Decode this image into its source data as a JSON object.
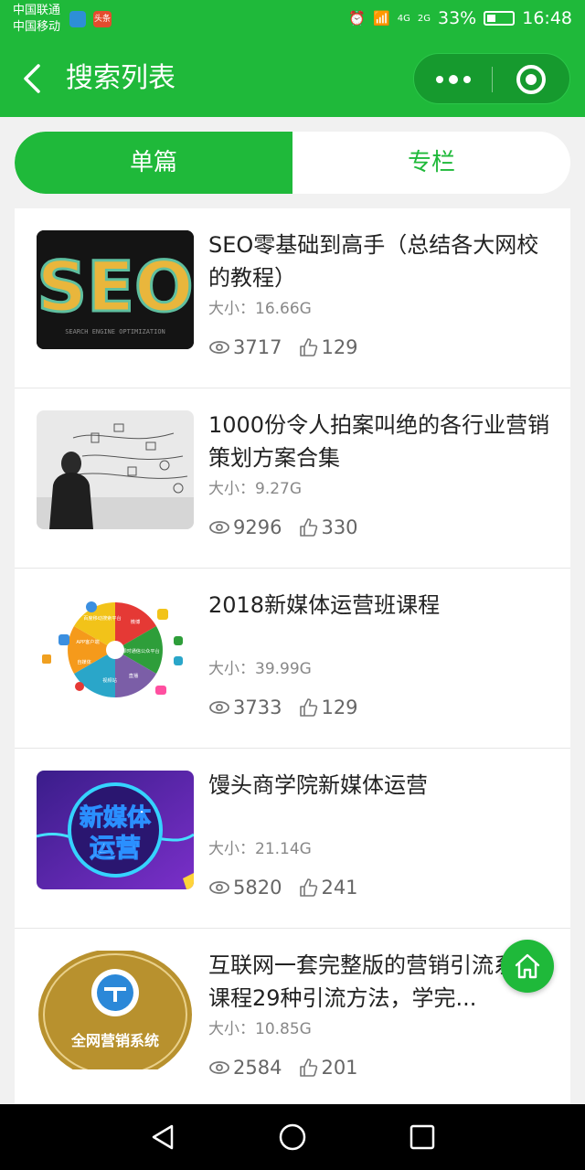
{
  "status_bar": {
    "carrier1": "中国联通",
    "carrier2": "中国移动",
    "app_badge": "头条",
    "net1": "4G",
    "net2": "2G",
    "battery": "33%",
    "time": "16:48"
  },
  "nav": {
    "title": "搜索列表"
  },
  "tabs": [
    {
      "label": "单篇"
    },
    {
      "label": "专栏"
    }
  ],
  "items": [
    {
      "title": "SEO零基础到高手（总结各大网校的教程）",
      "size": "大小：16.66G",
      "views": "3717",
      "likes": "129",
      "thumb_text": "SEO",
      "thumb_sub": "SEARCH ENGINE OPTIMIZATION"
    },
    {
      "title": "1000份令人拍案叫绝的各行业营销策划方案合集",
      "size": "大小：9.27G",
      "views": "9296",
      "likes": "330"
    },
    {
      "title": "2018新媒体运营班课程",
      "size": "大小：39.99G",
      "views": "3733",
      "likes": "129",
      "thumb_labels": [
        "百度移动搜索平台",
        "微博",
        "即时通信公众平台",
        "直播",
        "视频站",
        "自媒体",
        "APP客户端"
      ]
    },
    {
      "title": "馒头商学院新媒体运营",
      "size": "大小：21.14G",
      "views": "5820",
      "likes": "241",
      "thumb_line1": "新媒体",
      "thumb_line2": "运营"
    },
    {
      "title": "互联网一套完整版的营销引流系列课程29种引流方法，学完...",
      "size": "大小：10.85G",
      "views": "2584",
      "likes": "201",
      "thumb_text": "全网营销系统"
    }
  ],
  "colors": {
    "brand_green": "#1fb93a"
  }
}
